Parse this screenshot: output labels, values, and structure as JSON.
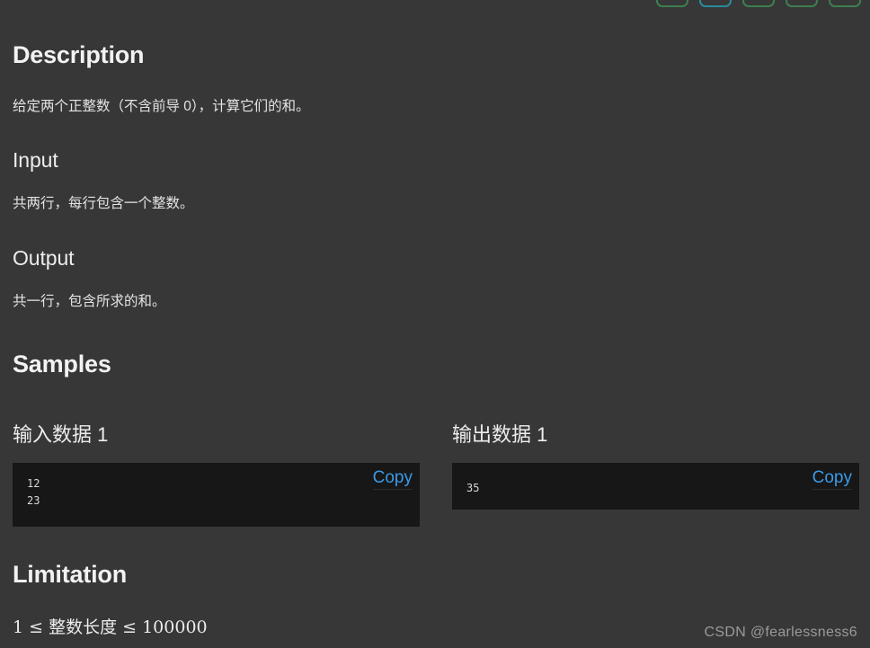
{
  "theme": {
    "page_bg": "#373737",
    "code_bg": "#171717",
    "link_color": "#3a9ae8",
    "heading_color": "#f2f2f2",
    "chip_green": "#3d7f4f",
    "chip_teal": "#2b8b9c"
  },
  "toolbar": {
    "chips": [
      {
        "name": "toolbar-chip-1",
        "color": "green"
      },
      {
        "name": "toolbar-chip-2",
        "color": "teal"
      },
      {
        "name": "toolbar-chip-3",
        "color": "green"
      },
      {
        "name": "toolbar-chip-4",
        "color": "green"
      },
      {
        "name": "toolbar-chip-5",
        "color": "green"
      }
    ]
  },
  "sections": {
    "description": {
      "title": "Description",
      "body": "给定两个正整数（不含前导 0），计算它们的和。"
    },
    "input": {
      "title": "Input",
      "body": "共两行，每行包含一个整数。"
    },
    "output": {
      "title": "Output",
      "body": "共一行，包含所求的和。"
    },
    "samples": {
      "title": "Samples",
      "input": {
        "label": "输入数据 1",
        "code": "12\n23",
        "copy_label": "Copy"
      },
      "output": {
        "label": "输出数据 1",
        "code": "35",
        "copy_label": "Copy"
      }
    },
    "limitation": {
      "title": "Limitation",
      "body": "1 ≤ 整数长度 ≤ 100000"
    }
  },
  "watermark": "CSDN @fearlessness6"
}
